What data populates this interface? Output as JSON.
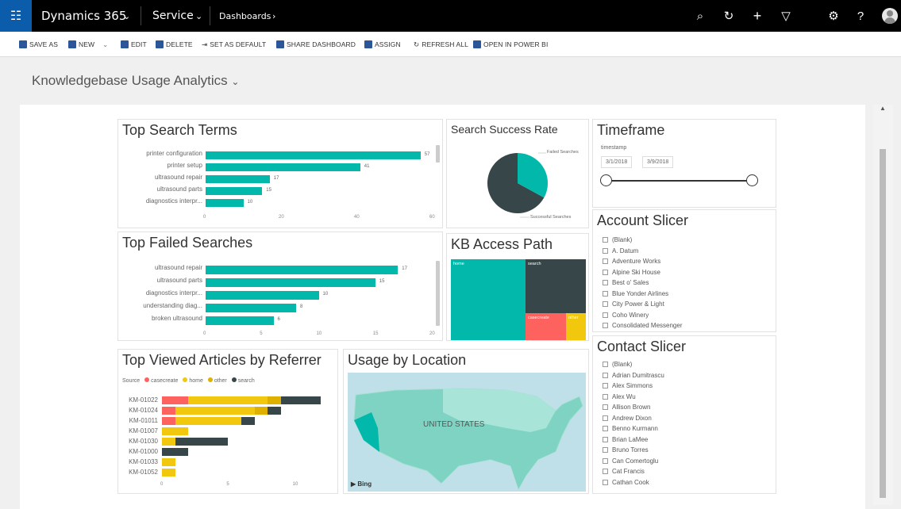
{
  "topbar": {
    "app_name": "Dynamics 365",
    "area": "Service",
    "breadcrumb": "Dashboards"
  },
  "commands": [
    {
      "label": "SAVE AS"
    },
    {
      "label": "NEW"
    },
    {
      "label": "EDIT"
    },
    {
      "label": "DELETE"
    },
    {
      "label": "SET AS DEFAULT"
    },
    {
      "label": "SHARE DASHBOARD"
    },
    {
      "label": "ASSIGN"
    },
    {
      "label": "REFRESH ALL"
    },
    {
      "label": "OPEN IN POWER BI"
    }
  ],
  "dashboard": {
    "title": "Knowledgebase Usage Analytics"
  },
  "colors": {
    "accent_teal": "#01b8aa",
    "dark": "#374649",
    "red": "#fd625e",
    "yellow": "#f2c80f",
    "header_blue": "#0b5cab"
  },
  "top_search_terms": {
    "title": "Top Search Terms",
    "chart_data": {
      "type": "bar",
      "categories": [
        "printer configuration",
        "printer setup",
        "ultrasound repair",
        "ultrasound parts",
        "diagnostics interpr..."
      ],
      "values": [
        57,
        41,
        17,
        15,
        10
      ],
      "xticks": [
        "0",
        "20",
        "40",
        "60"
      ],
      "xlim": [
        0,
        60
      ]
    }
  },
  "search_success": {
    "title": "Search Success Rate",
    "chart_data": {
      "type": "pie",
      "labels": [
        "Failed Searches",
        "Successful Searches"
      ],
      "values": [
        33,
        67
      ]
    }
  },
  "timeframe": {
    "title": "Timeframe",
    "field": "timestamp",
    "start": "3/1/2018",
    "end": "3/9/2018"
  },
  "top_failed": {
    "title": "Top Failed Searches",
    "chart_data": {
      "type": "bar",
      "categories": [
        "ultrasound repair",
        "ultrasound parts",
        "diagnostics interpr...",
        "understanding diag...",
        "broken ultrasound"
      ],
      "values": [
        17,
        15,
        10,
        8,
        6
      ],
      "xticks": [
        "0",
        "5",
        "10",
        "15",
        "20"
      ],
      "xlim": [
        0,
        20
      ]
    }
  },
  "kb_access": {
    "title": "KB Access Path",
    "chart_data": {
      "type": "treemap",
      "labels": [
        "home",
        "search",
        "casecreate",
        "other"
      ],
      "colors": [
        "#01b8aa",
        "#374649",
        "#fd625e",
        "#f2c80f"
      ]
    }
  },
  "account_slicer": {
    "title": "Account Slicer",
    "items": [
      "(Blank)",
      "A. Datum",
      "Adventure Works",
      "Alpine Ski House",
      "Best o' Sales",
      "Blue Yonder Airlines",
      "City Power & Light",
      "Coho Winery",
      "Consolidated Messenger"
    ]
  },
  "contact_slicer": {
    "title": "Contact Slicer",
    "items": [
      "(Blank)",
      "Adrian Dumitrascu",
      "Alex Simmons",
      "Alex Wu",
      "Allison Brown",
      "Andrew Dixon",
      "Benno Kurmann",
      "Brian LaMee",
      "Bruno Torres",
      "Can Comertoglu",
      "Cat Francis",
      "Cathan Cook"
    ]
  },
  "top_viewed": {
    "title": "Top Viewed Articles by Referrer",
    "legend_title": "Source",
    "chart_data": {
      "type": "bar",
      "stacked": true,
      "categories": [
        "KM-01022",
        "KM-01024",
        "KM-01011",
        "KM-01007",
        "KM-01030",
        "KM-01000",
        "KM-01033",
        "KM-01052"
      ],
      "series": [
        {
          "name": "casecreate",
          "values": [
            2,
            1,
            1,
            0,
            0,
            0,
            0,
            0
          ]
        },
        {
          "name": "home",
          "values": [
            6,
            6,
            5,
            2,
            1,
            0,
            1,
            1
          ]
        },
        {
          "name": "other",
          "values": [
            1,
            1,
            0,
            0,
            0,
            0,
            0,
            0
          ]
        },
        {
          "name": "search",
          "values": [
            3,
            1,
            1,
            0,
            4,
            2,
            0,
            0
          ]
        }
      ],
      "xticks": [
        "0",
        "5",
        "10"
      ],
      "xlim": [
        0,
        12
      ]
    }
  },
  "usage_location": {
    "title": "Usage by Location",
    "map_label": "UNITED STATES",
    "attribution": "Bing"
  }
}
